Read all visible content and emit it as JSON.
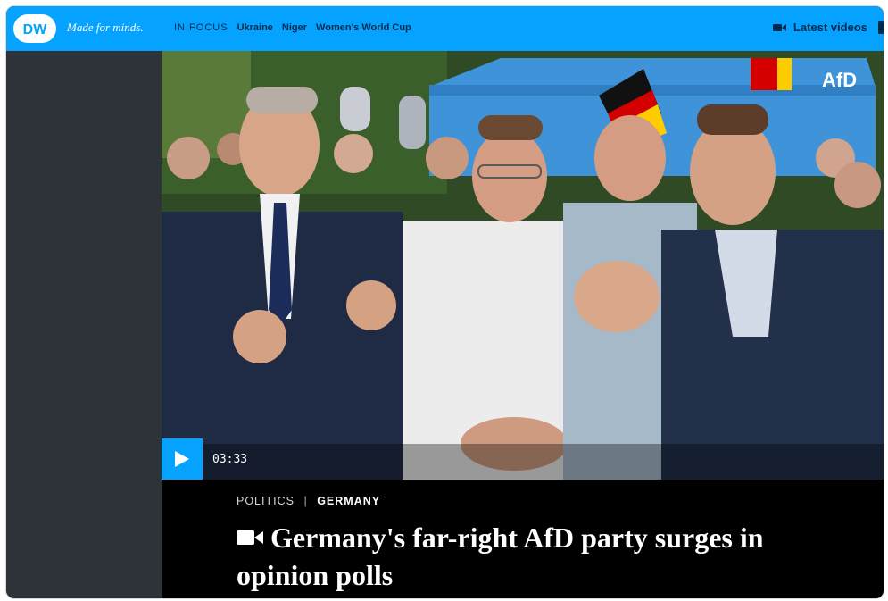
{
  "header": {
    "logo_text": "DW",
    "tagline": "Made for minds.",
    "in_focus": "IN FOCUS",
    "nav_links": [
      "Ukraine",
      "Niger",
      "Women's World Cup"
    ],
    "latest_videos": "Latest videos"
  },
  "video": {
    "duration": "03:33"
  },
  "article": {
    "category": "POLITICS",
    "separator": "|",
    "subcategory": "GERMANY",
    "headline": "Germany's far-right AfD party surges in opinion polls"
  },
  "colors": {
    "brand_blue": "#05a2ff",
    "nav_text": "#002a4b",
    "caption_bg": "#000000"
  },
  "icons": {
    "play": "play-icon",
    "camera": "video-camera-icon"
  }
}
